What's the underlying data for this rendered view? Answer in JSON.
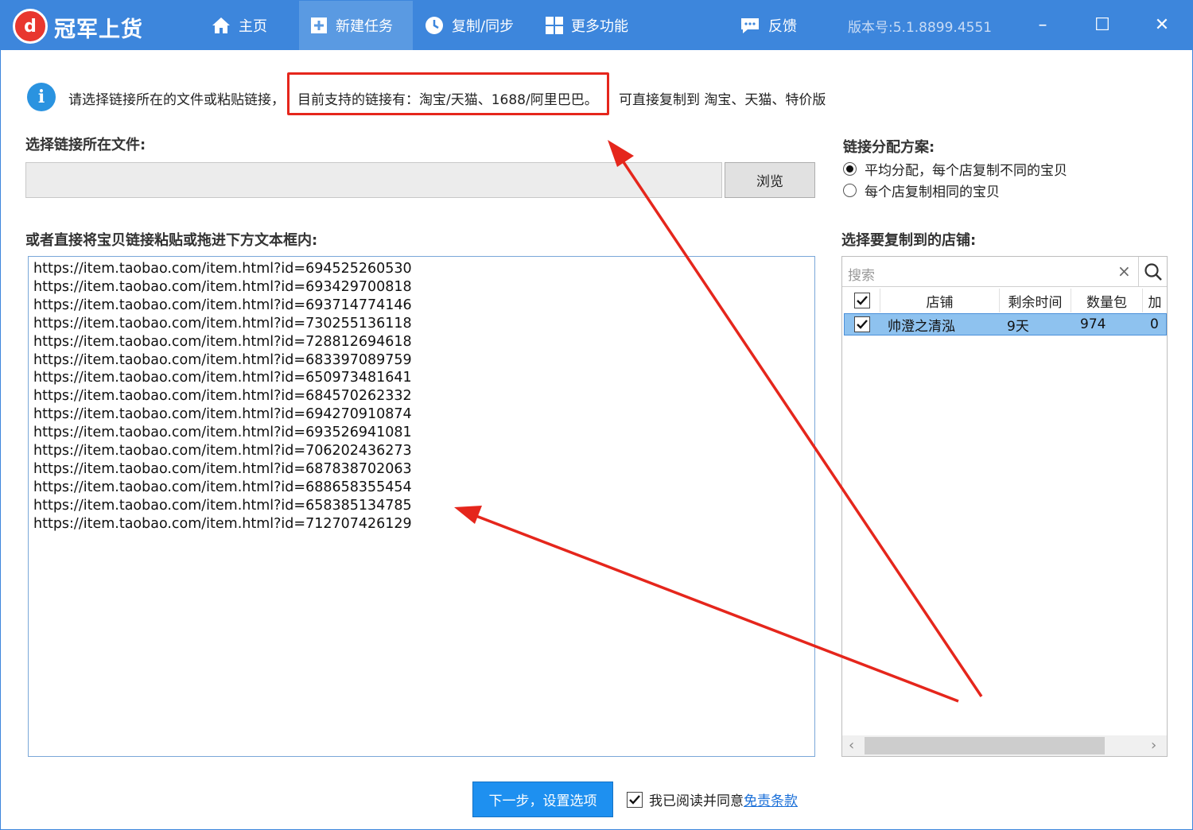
{
  "app": {
    "logo_glyph": "d",
    "title": "冠军上货",
    "version": "版本号:5.1.8899.4551",
    "accent": "#3d86dc"
  },
  "nav": {
    "items": [
      {
        "label": "主页",
        "icon": "home-icon"
      },
      {
        "label": "新建任务",
        "icon": "new-task-icon",
        "active": true
      },
      {
        "label": "复制/同步",
        "icon": "clock-icon"
      },
      {
        "label": "更多功能",
        "icon": "grid-icon"
      },
      {
        "label": "反馈",
        "icon": "feedback-icon"
      }
    ]
  },
  "window": {
    "minimize": "–",
    "maximize": "☐",
    "close": "✕"
  },
  "info": {
    "icon": "i",
    "part1": "请选择链接所在的文件或粘贴链接，",
    "part2": "目前支持的链接有：淘宝/天猫、1688/阿里巴巴。",
    "part3": "可直接复制到 淘宝、天猫、特价版"
  },
  "file_section": {
    "label": "选择链接所在文件:",
    "value": "",
    "browse_label": "浏览"
  },
  "paste_section": {
    "label": "或者直接将宝贝链接粘贴或拖进下方文本框内:",
    "links": [
      "https://item.taobao.com/item.html?id=694525260530",
      "https://item.taobao.com/item.html?id=693429700818",
      "https://item.taobao.com/item.html?id=693714774146",
      "https://item.taobao.com/item.html?id=730255136118",
      "https://item.taobao.com/item.html?id=728812694618",
      "https://item.taobao.com/item.html?id=683397089759",
      "https://item.taobao.com/item.html?id=650973481641",
      "https://item.taobao.com/item.html?id=684570262332",
      "https://item.taobao.com/item.html?id=694270910874",
      "https://item.taobao.com/item.html?id=693526941081",
      "https://item.taobao.com/item.html?id=706202436273",
      "https://item.taobao.com/item.html?id=687838702063",
      "https://item.taobao.com/item.html?id=688658355454",
      "https://item.taobao.com/item.html?id=658385134785",
      "https://item.taobao.com/item.html?id=712707426129"
    ]
  },
  "distribution": {
    "label": "链接分配方案:",
    "options": [
      {
        "label": "平均分配，每个店复制不同的宝贝",
        "checked": true
      },
      {
        "label": "每个店复制相同的宝贝",
        "checked": false
      }
    ]
  },
  "shops": {
    "label": "选择要复制到的店铺:",
    "search_placeholder": "搜索",
    "columns": [
      "店铺",
      "剩余时间",
      "数量包",
      "加"
    ],
    "rows": [
      {
        "checked": true,
        "shop": "帅澄之清泓",
        "remaining": "9天",
        "packages": "974",
        "extra": "0"
      }
    ]
  },
  "footer": {
    "next_label": "下一步，设置选项",
    "agree_checked": true,
    "agree_text": "我已阅读并同意",
    "agree_link": "免责条款"
  },
  "colors": {
    "annotation_red": "#e5261c",
    "selected_row": "#8ec2ef",
    "primary_button": "#1e90f0"
  }
}
